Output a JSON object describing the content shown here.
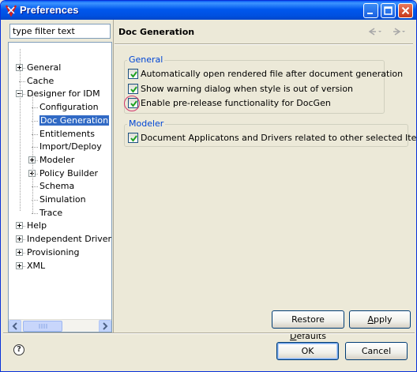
{
  "window": {
    "title": "Preferences"
  },
  "filter": {
    "placeholder": "type filter text",
    "value": "type filter text"
  },
  "tree": {
    "items": [
      {
        "label": "General",
        "expander": "plus"
      },
      {
        "label": "Cache",
        "expander": "none"
      },
      {
        "label": "Designer for IDM",
        "expander": "minus"
      },
      {
        "label": "Configuration",
        "expander": "none"
      },
      {
        "label": "Doc Generation",
        "expander": "none",
        "selected": true
      },
      {
        "label": "Entitlements",
        "expander": "none"
      },
      {
        "label": "Import/Deploy",
        "expander": "none"
      },
      {
        "label": "Modeler",
        "expander": "plus"
      },
      {
        "label": "Policy Builder",
        "expander": "plus"
      },
      {
        "label": "Schema",
        "expander": "none"
      },
      {
        "label": "Simulation",
        "expander": "none"
      },
      {
        "label": "Trace",
        "expander": "none"
      },
      {
        "label": "Help",
        "expander": "plus"
      },
      {
        "label": "Independent Driver S",
        "expander": "plus"
      },
      {
        "label": "Provisioning",
        "expander": "plus"
      },
      {
        "label": "XML",
        "expander": "plus"
      }
    ]
  },
  "page": {
    "title": "Doc Generation",
    "groups": {
      "general": {
        "legend": "General",
        "options": [
          {
            "label": "Automatically open rendered file after document generation",
            "checked": true
          },
          {
            "label": "Show warning dialog when style is out of version",
            "checked": true
          },
          {
            "label": "Enable pre-release functionality for DocGen",
            "checked": true
          }
        ]
      },
      "modeler": {
        "legend": "Modeler",
        "options": [
          {
            "label": "Document Applicatons and Drivers related to other selected Items",
            "checked": true
          }
        ]
      }
    },
    "restore_defaults": {
      "pre": "Restore ",
      "key": "D",
      "post": "efaults"
    },
    "apply": {
      "key": "A",
      "post": "pply"
    }
  },
  "footer": {
    "help": "?",
    "ok": "OK",
    "cancel": "Cancel"
  },
  "colors": {
    "titlebar": "#0058ee",
    "selection": "#316ac5",
    "group_legend": "#0046d5",
    "highlight_circle": "#d3366c"
  },
  "icons": {
    "app": "idm-app-icon",
    "back": "back-arrow-icon",
    "forward": "forward-arrow-icon"
  }
}
